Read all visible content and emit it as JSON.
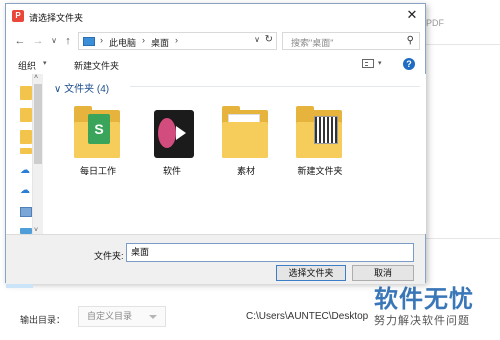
{
  "background": {
    "pdf_label": "PDF",
    "output_label": "输出目录：",
    "output_select": "自定义目录",
    "output_path": "C:\\Users\\AUNTEC\\Desktop"
  },
  "watermark": {
    "title": "软件无忧",
    "subtitle": "努力解决软件问题"
  },
  "dialog": {
    "title": "请选择文件夹",
    "app_icon_text": "P",
    "close": "✕",
    "nav": {
      "back": "←",
      "forward": "→",
      "recent": "∨",
      "up": "↑"
    },
    "address": {
      "crumb1": "此电脑",
      "crumb2": "桌面",
      "sep": "›",
      "dropdown": "∨",
      "refresh": "↻"
    },
    "search": {
      "placeholder": "搜索\"桌面\""
    },
    "toolbar": {
      "organize": "组织",
      "caret": "▾",
      "new_folder": "新建文件夹",
      "view_caret": "▾",
      "help": "?"
    },
    "nav_pane": {
      "up": "˄",
      "down": "˅"
    },
    "group": {
      "chevron": "∨",
      "title": "文件夹 (4)"
    },
    "items": [
      {
        "label": "每日工作"
      },
      {
        "label": "软件"
      },
      {
        "label": "素材"
      },
      {
        "label": "新建文件夹"
      }
    ],
    "sheet_glyph": "S",
    "footer": {
      "folder_label": "文件夹:",
      "folder_value": "桌面",
      "select_button": "选择文件夹",
      "cancel_button": "取消"
    }
  },
  "colors": {
    "accent": "#1f6dc2",
    "folder": "#f6cd5a",
    "watermark": "#3a77b8"
  }
}
